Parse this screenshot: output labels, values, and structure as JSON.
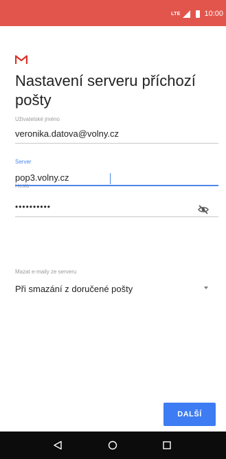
{
  "status_bar": {
    "network": "LTE",
    "time": "10:00",
    "background": "#e2554c"
  },
  "app": {
    "logo_icon": "gmail-icon"
  },
  "title": "Nastavení serveru příchozí pošty",
  "fields": {
    "username": {
      "label": "Uživatelské jméno",
      "value": "veronika.datova@volny.cz"
    },
    "password": {
      "label": "Heslo",
      "value": "••••••••••",
      "toggle_icon": "visibility-off-icon"
    },
    "server": {
      "label": "Server",
      "value": "pop3.volny.cz",
      "accent_color": "#4a86e8"
    },
    "delete_mail": {
      "label": "Mazat e-maily ze serveru",
      "value": "Při smazání z doručené pošty",
      "dropdown_icon": "dropdown-arrow-icon"
    }
  },
  "actions": {
    "next_label": "DALŠÍ",
    "next_color": "#3d7cf2"
  },
  "nav_bar": {
    "back_icon": "back-icon",
    "home_icon": "home-icon",
    "recent_icon": "recent-apps-icon"
  }
}
